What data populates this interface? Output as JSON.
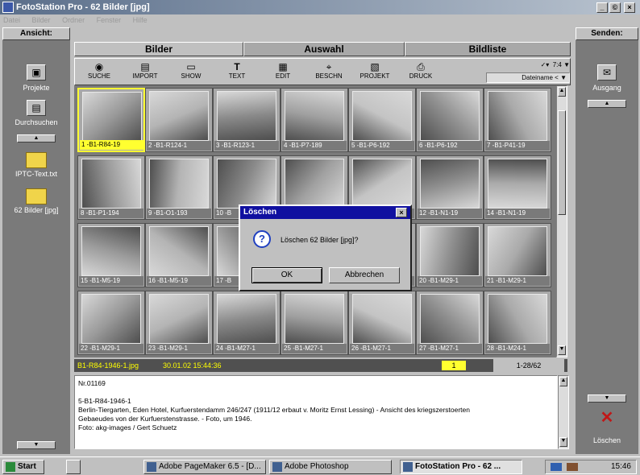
{
  "window": {
    "title": "FotoStation Pro - 62 Bilder [jpg]",
    "controls": [
      "_",
      "©",
      "×"
    ]
  },
  "menu": [
    "Datei",
    "Bilder",
    "Ordner",
    "Fenster",
    "Hilfe"
  ],
  "left_panel": {
    "header": "Ansicht:",
    "items": [
      {
        "label": "Projekte"
      },
      {
        "label": "Durchsuchen"
      },
      {
        "label": "IPTC-Text.txt"
      },
      {
        "label": "62 Bilder [jpg]"
      }
    ]
  },
  "tabs": [
    {
      "label": "Bilder"
    },
    {
      "label": "Auswahl"
    },
    {
      "label": "Bildliste"
    }
  ],
  "toolbar": {
    "buttons": [
      "SUCHE",
      "IMPORT",
      "SHOW",
      "TEXT",
      "EDIT",
      "BESCHN",
      "PROJEKT",
      "DRUCK"
    ],
    "view_value": "7:4",
    "sort_value": "Dateiname <"
  },
  "thumbnails": [
    "1 -B1-R84-19",
    "2 -B1-R124-1",
    "3 -B1-R123-1",
    "4 -B1-P7-189",
    "5 -B1-P6-192",
    "6 -B1-P6-192",
    "7 -B1-P41-19",
    "8 -B1-P1-194",
    "9 -B1-O1-193",
    "10 -B",
    "",
    "",
    "12 -B1-N1-19",
    "14 -B1-N1-19",
    "15 -B1-M5-19",
    "16 -B1-M5-19",
    "17 -B",
    "",
    "",
    "20 -B1-M29-1",
    "21 -B1-M29-1",
    "22 -B1-M29-1",
    "23 -B1-M29-1",
    "24 -B1-M27-1",
    "25 -B1-M27-1",
    "26 -B1-M27-1",
    "27 -B1-M27-1",
    "28 -B1-M24-1"
  ],
  "status": {
    "file": "B1-R84-1946-1.jpg",
    "date": "30.01.02 15:44:36",
    "index": "1",
    "range": "1-28/62"
  },
  "description": {
    "lines": [
      "Nr.01169",
      "",
      "5-B1-R84-1946-1",
      "Berlin-Tiergarten, Eden Hotel, Kurfuerstendamm 246/247 (1911/12 erbaut v. Moritz Ernst Lessing) - Ansicht des kriegszerstoerten",
      "Gebaeudes von der Kurfuerstenstrasse. - Foto, um 1946.",
      "Foto: akg-images / Gert Schuetz"
    ]
  },
  "right_panel": {
    "header": "Senden:",
    "ausgang": "Ausgang",
    "loeschen": "Löschen"
  },
  "dialog": {
    "title": "Löschen",
    "message": "Löschen 62 Bilder [jpg]?",
    "ok": "OK",
    "cancel": "Abbrechen"
  },
  "taskbar": {
    "start": "Start",
    "tasks": [
      "Adobe PageMaker 6.5 - [D...",
      "Adobe Photoshop",
      "FotoStation Pro - 62 ..."
    ],
    "clock": "15:46"
  },
  "colors": {
    "title_start": "#5a6e8a",
    "dialog_title": "#1010a0",
    "selection": "#ffff30",
    "status_text": "#ffff00"
  }
}
